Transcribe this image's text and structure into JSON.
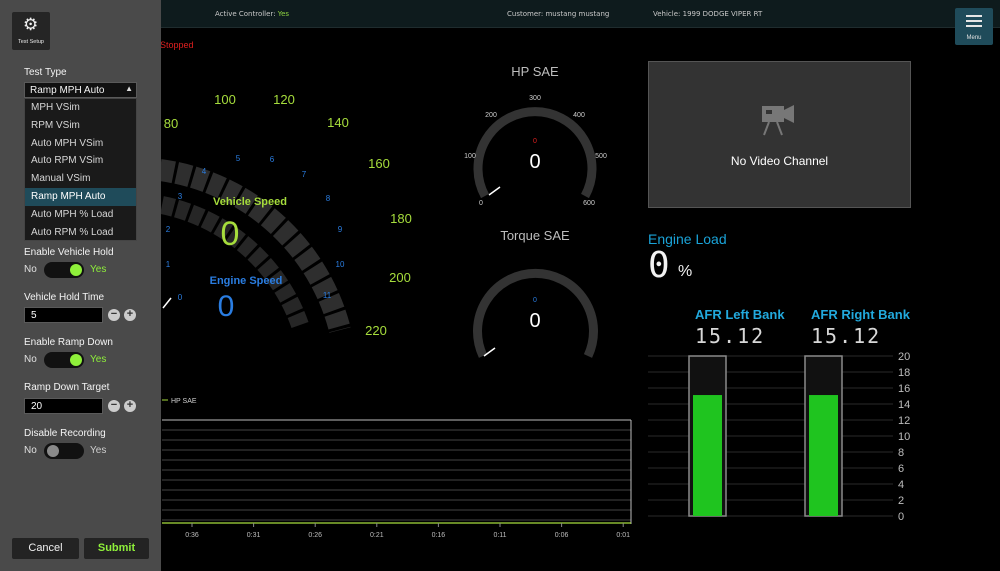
{
  "topbar": {
    "active_controller_label": "Active Controller:",
    "active_controller_value": "Yes",
    "customer": "Customer: mustang mustang",
    "vehicle": "Vehicle: 1999 DODGE VIPER RT",
    "menu_label": "Menu",
    "menu_icon": "hamburger-menu-icon"
  },
  "status": "Stopped",
  "left_panel": {
    "test_setup_label": "Test Setup",
    "test_setup_icon": "gear-icon",
    "test_type_label": "Test Type",
    "test_type_selected": "Ramp MPH Auto",
    "test_type_options": [
      "MPH VSim",
      "RPM VSim",
      "Auto MPH VSim",
      "Auto RPM VSim",
      "Manual VSim",
      "Ramp MPH Auto",
      "Auto MPH % Load",
      "Auto RPM % Load"
    ],
    "enable_vehicle_hold_label": "Enable Vehicle Hold",
    "enable_vehicle_hold_no": "No",
    "enable_vehicle_hold_yes": "Yes",
    "enable_vehicle_hold_on": true,
    "vehicle_hold_time_label": "Vehicle Hold Time",
    "vehicle_hold_time_value": "5",
    "enable_ramp_down_label": "Enable Ramp Down",
    "enable_ramp_down_no": "No",
    "enable_ramp_down_yes": "Yes",
    "enable_ramp_down_on": true,
    "ramp_down_target_label": "Ramp Down Target",
    "ramp_down_target_value": "20",
    "disable_recording_label": "Disable Recording",
    "disable_recording_no": "No",
    "disable_recording_yes": "Yes",
    "disable_recording_on": false,
    "minus": "−",
    "plus": "+",
    "cancel_label": "Cancel",
    "submit_label": "Submit"
  },
  "speed_gauge": {
    "speed_ticks": [
      "80",
      "100",
      "120",
      "140",
      "160",
      "180",
      "200",
      "220"
    ],
    "rpm_ticks": [
      "0",
      "1",
      "2",
      "3",
      "4",
      "5",
      "6",
      "7",
      "8",
      "9",
      "10",
      "11"
    ],
    "vehicle_speed_label": "Vehicle Speed",
    "vehicle_speed_value": "0",
    "engine_speed_label": "Engine Speed",
    "engine_speed_value": "0"
  },
  "hp_gauge": {
    "title": "HP SAE",
    "ticks": [
      "0",
      "100",
      "200",
      "300",
      "400",
      "500",
      "600"
    ],
    "peak": "0",
    "value": "0"
  },
  "torque_gauge": {
    "title": "Torque SAE",
    "peak": "0",
    "value": "0"
  },
  "video": {
    "icon": "video-camera-icon",
    "message": "No Video Channel"
  },
  "engine_load": {
    "label": "Engine Load",
    "value": "0",
    "unit": "%"
  },
  "afr": {
    "left_label": "AFR Left Bank",
    "left_value": "15.12",
    "right_label": "AFR Right Bank",
    "right_value": "15.12",
    "scale": [
      "20",
      "18",
      "16",
      "14",
      "12",
      "10",
      "8",
      "6",
      "4",
      "2",
      "0"
    ],
    "colors": {
      "bar_fill": "#1fc41f",
      "bar_border": "#8a8a8a"
    }
  },
  "chart_data": {
    "type": "line",
    "series": [
      {
        "name": "HP SAE",
        "values": []
      }
    ],
    "x_ticks": [
      "0:36",
      "0:31",
      "0:26",
      "0:21",
      "0:16",
      "0:11",
      "0:06",
      "0:01"
    ],
    "legend": "top-left"
  },
  "colors": {
    "accent": "#8ff03a",
    "blue": "#1aa3d8",
    "speed_green": "#a6dd3c",
    "engine_blue": "#2a7de1",
    "stopped_red": "#e01f1f"
  }
}
